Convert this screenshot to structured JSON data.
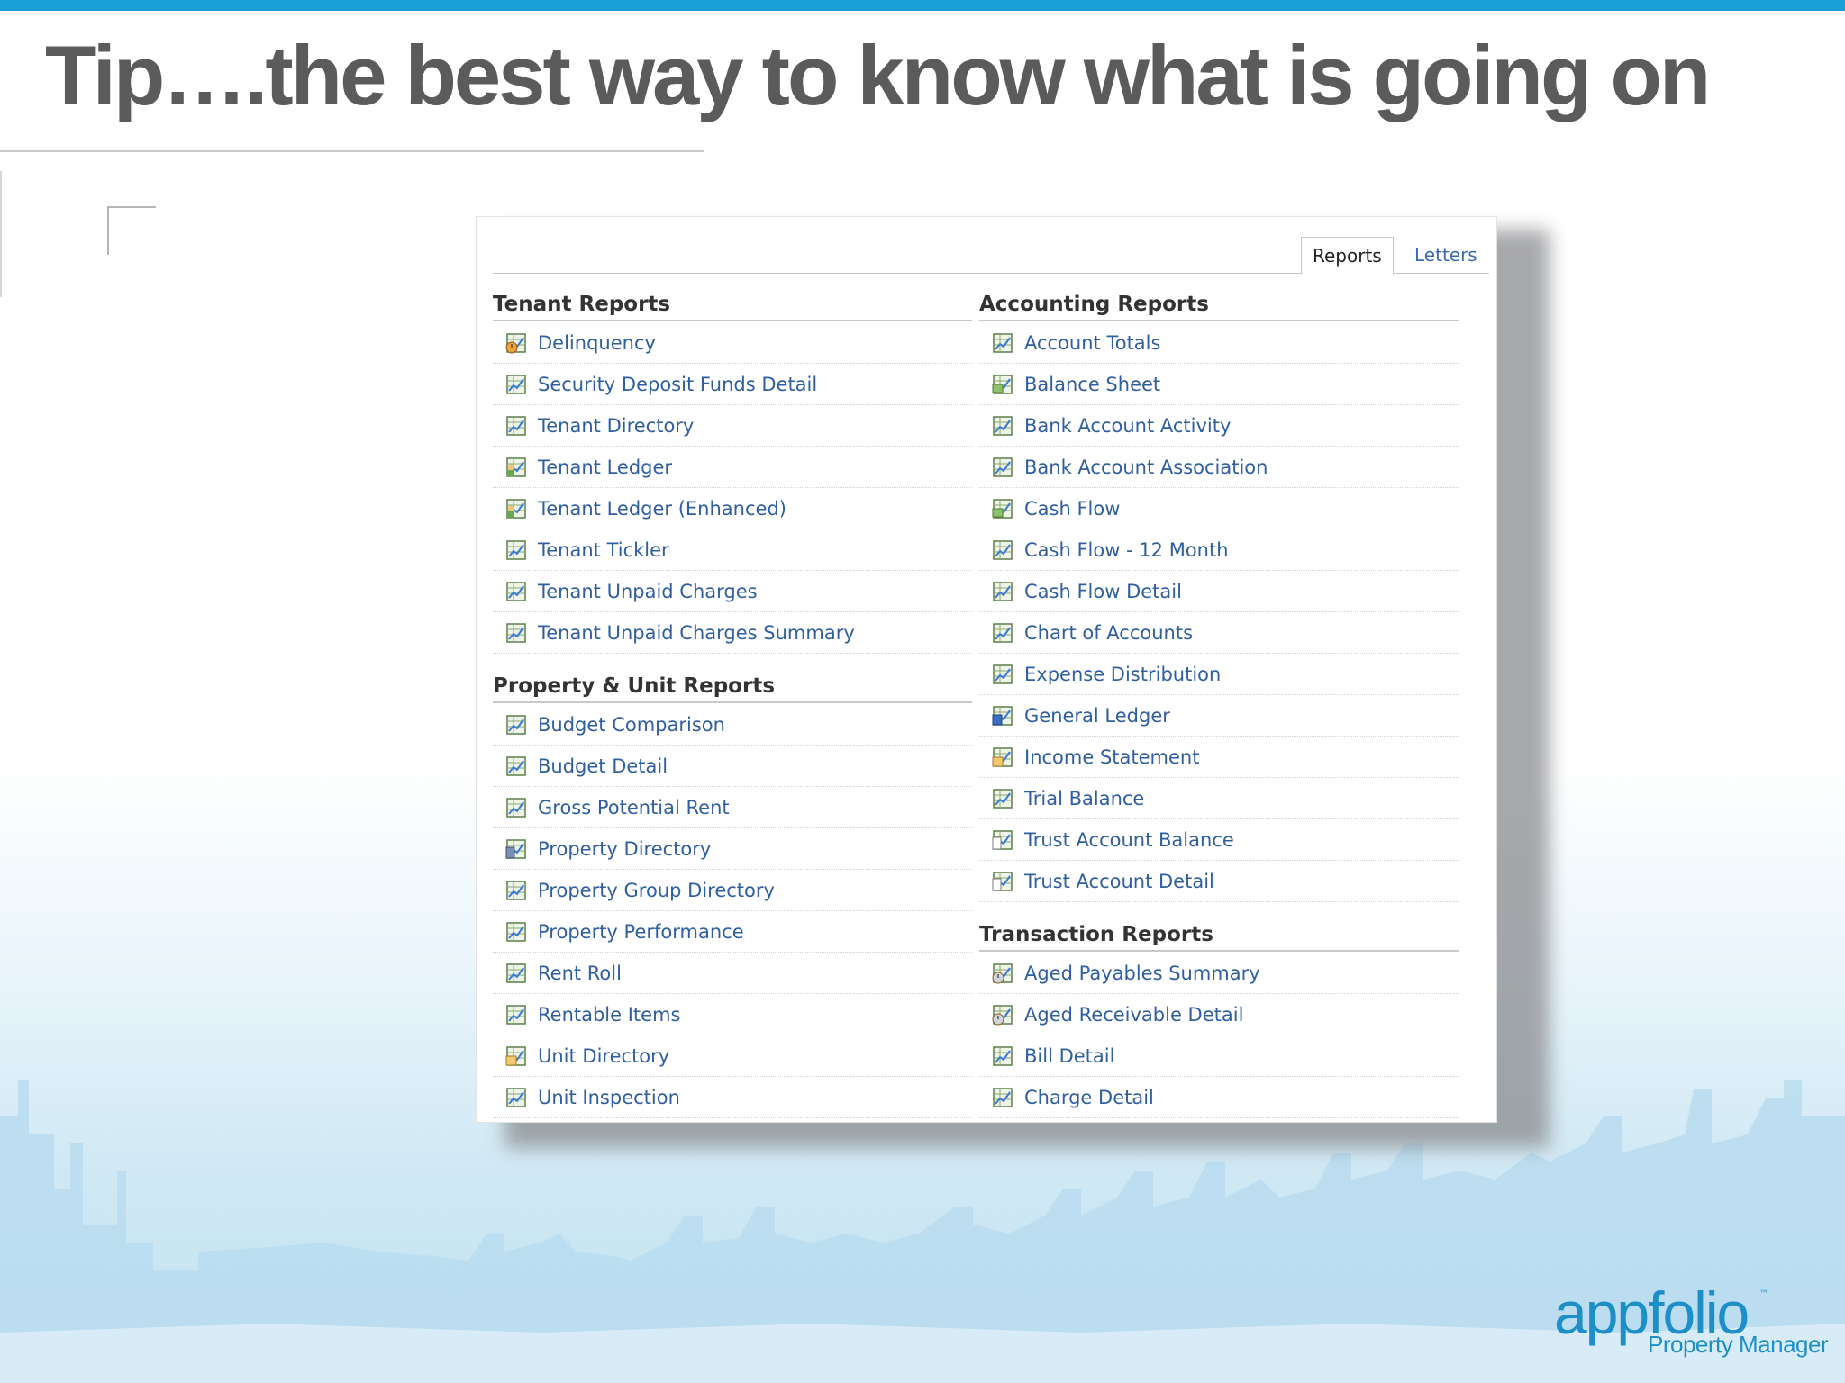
{
  "slide": {
    "title": "Tip….the best way to know what is going on"
  },
  "tabs": [
    {
      "label": "Reports",
      "active": true
    },
    {
      "label": "Letters",
      "active": false
    }
  ],
  "sections": {
    "tenant": {
      "heading": "Tenant Reports",
      "items": [
        {
          "label": "Delinquency",
          "icon": "delinquency-report-icon"
        },
        {
          "label": "Security Deposit Funds Detail",
          "icon": "report-icon"
        },
        {
          "label": "Tenant Directory",
          "icon": "report-icon"
        },
        {
          "label": "Tenant Ledger",
          "icon": "people-report-icon"
        },
        {
          "label": "Tenant Ledger (Enhanced)",
          "icon": "people-report-icon"
        },
        {
          "label": "Tenant Tickler",
          "icon": "report-icon"
        },
        {
          "label": "Tenant Unpaid Charges",
          "icon": "report-icon"
        },
        {
          "label": "Tenant Unpaid Charges Summary",
          "icon": "report-icon"
        }
      ]
    },
    "property_unit": {
      "heading": "Property & Unit Reports",
      "items": [
        {
          "label": "Budget Comparison",
          "icon": "report-icon"
        },
        {
          "label": "Budget Detail",
          "icon": "report-icon"
        },
        {
          "label": "Gross Potential Rent",
          "icon": "report-icon"
        },
        {
          "label": "Property Directory",
          "icon": "building-report-icon"
        },
        {
          "label": "Property Group Directory",
          "icon": "report-icon"
        },
        {
          "label": "Property Performance",
          "icon": "report-icon"
        },
        {
          "label": "Rent Roll",
          "icon": "report-icon"
        },
        {
          "label": "Rentable Items",
          "icon": "report-icon"
        },
        {
          "label": "Unit Directory",
          "icon": "box-report-icon"
        },
        {
          "label": "Unit Inspection",
          "icon": "report-icon"
        }
      ]
    },
    "accounting": {
      "heading": "Accounting Reports",
      "items": [
        {
          "label": "Account Totals",
          "icon": "report-icon"
        },
        {
          "label": "Balance Sheet",
          "icon": "money-report-icon"
        },
        {
          "label": "Bank Account Activity",
          "icon": "report-icon"
        },
        {
          "label": "Bank Account Association",
          "icon": "report-icon"
        },
        {
          "label": "Cash Flow",
          "icon": "money-report-icon"
        },
        {
          "label": "Cash Flow - 12 Month",
          "icon": "report-icon"
        },
        {
          "label": "Cash Flow Detail",
          "icon": "report-icon"
        },
        {
          "label": "Chart of Accounts",
          "icon": "report-icon"
        },
        {
          "label": "Expense Distribution",
          "icon": "report-icon"
        },
        {
          "label": "General Ledger",
          "icon": "ledger-report-icon"
        },
        {
          "label": "Income Statement",
          "icon": "folder-report-icon"
        },
        {
          "label": "Trial Balance",
          "icon": "report-icon"
        },
        {
          "label": "Trust Account Balance",
          "icon": "document-report-icon"
        },
        {
          "label": "Trust Account Detail",
          "icon": "document-report-icon"
        }
      ]
    },
    "transaction": {
      "heading": "Transaction Reports",
      "items": [
        {
          "label": "Aged Payables Summary",
          "icon": "clock-report-icon"
        },
        {
          "label": "Aged Receivable Detail",
          "icon": "clock-report-icon"
        },
        {
          "label": "Bill Detail",
          "icon": "report-icon"
        },
        {
          "label": "Charge Detail",
          "icon": "report-icon"
        }
      ]
    }
  },
  "logo": {
    "word": "appfolio",
    "tm": "™",
    "sub": "Property Manager"
  },
  "colors": {
    "accent_bar": "#1aa0d8",
    "title_text": "#5b5b5b",
    "link_text": "#2f5f9f",
    "heading_text": "#333333",
    "logo": "#1d8fc8"
  }
}
